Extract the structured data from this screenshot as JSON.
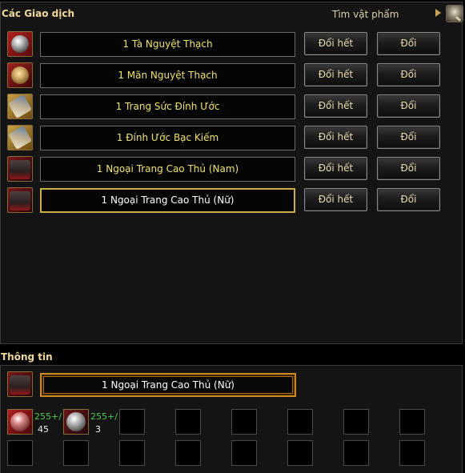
{
  "header": {
    "title": "Các Giao dịch",
    "search_label": "Tìm vật phẩm"
  },
  "trades": [
    {
      "icon": "ta-nguyet-thach-icon",
      "name": "1 Tà Nguyệt Thạch",
      "all_label": "Đổi hết",
      "one_label": "Đổi"
    },
    {
      "icon": "man-nguyet-thach-icon",
      "name": "1 Mãn Nguyệt Thạch",
      "all_label": "Đổi hết",
      "one_label": "Đổi"
    },
    {
      "icon": "trang-suc-dinh-uoc-icon",
      "name": "1 Trang Sức Đính Ước",
      "all_label": "Đổi hết",
      "one_label": "Đổi"
    },
    {
      "icon": "dinh-uoc-bac-kiem-icon",
      "name": "1 Đính Ước Bạc Kiếm",
      "all_label": "Đổi hết",
      "one_label": "Đổi"
    },
    {
      "icon": "ngoai-trang-nam-icon",
      "name": "1 Ngoại Trang Cao Thủ (Nam)",
      "all_label": "Đổi hết",
      "one_label": "Đổi"
    },
    {
      "icon": "ngoai-trang-nu-icon",
      "name": "1 Ngoại Trang Cao Thủ (Nữ)",
      "all_label": "Đổi hết",
      "one_label": "Đổi",
      "selected": true
    }
  ],
  "info": {
    "title": "Thông tin",
    "item_name": "1 Ngoại Trang Cao Thủ (Nữ)",
    "materials": [
      {
        "icon": "red-stone-icon",
        "plus": "255+/",
        "count": "45"
      },
      {
        "icon": "gray-stone-icon",
        "plus": "255+/",
        "count": "3"
      }
    ]
  },
  "colors": {
    "text_gold": "#f0e270",
    "title_gold": "#f0d89a",
    "selected_border": "#c9b04a",
    "info_border": "#d08a20",
    "material_green": "#4ec84e"
  }
}
